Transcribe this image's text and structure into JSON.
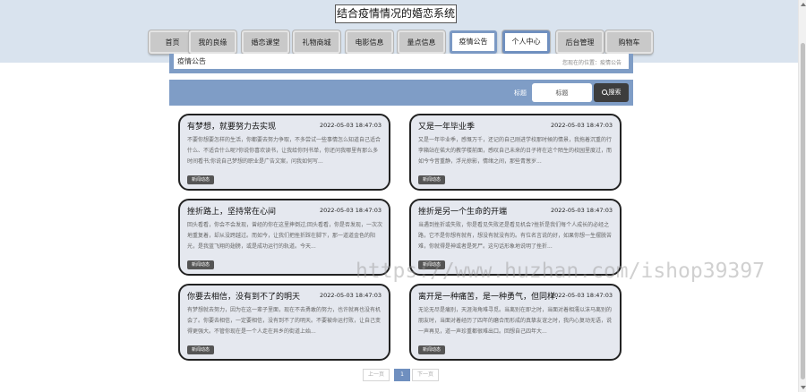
{
  "site": {
    "title": "结合疫情情况的婚恋系统"
  },
  "nav": [
    {
      "label": "首页"
    },
    {
      "label": "我的良缘"
    },
    {
      "label": "婚恋课堂"
    },
    {
      "label": "礼物商城"
    },
    {
      "label": "电影信息"
    },
    {
      "label": "量点信息"
    },
    {
      "label": "疫情公告"
    },
    {
      "label": "个人中心"
    },
    {
      "label": "后台管理"
    },
    {
      "label": "购物车"
    }
  ],
  "breadcrumb": {
    "title": "疫情公告",
    "path": "您现在的位置：疫情公告"
  },
  "search": {
    "label": "标题",
    "placeholder": "标题",
    "button": "搜索"
  },
  "articles": [
    {
      "title": "有梦想，就要努力去实现",
      "date": "2022-05-03 18:47:03",
      "excerpt": "不要你想要怎样的生活，你都要去努力争取，不多尝试一些事情怎么知道自己适合什么、不适合什么呢?你说你喜欢读书，让我给你列书单，你还问我哪里有那么多时间看书;你说自己梦想的职业是广告文案，问我如何写...",
      "tag": "新闻动态"
    },
    {
      "title": "又是一年毕业季",
      "date": "2022-05-03 18:47:03",
      "excerpt": "又是一年毕业季，感慨万千，还记的自己刚进学校那时候的情景，我拖着沉重的行李箱站在偌大的教学楼前面，感叹自己未来的日子将在这个陌生的校园里度过，而如今今昔重静，浮光掠影，情绪之间，那些青葱岁...",
      "tag": "新闻动态"
    },
    {
      "title": "挫折路上，坚持常在心间",
      "date": "2022-05-03 18:47:03",
      "excerpt": "回头看看，你会不会发现，曾经的你在这里摔倒过;回头看看，你是否发现，一次次地重复着，却从没跨越过。而如今，让我们把挫折踩在脚下，那一道道金色的阳光，是我蓝飞翔的翅膀，或是成功运行的轨道。今天...",
      "tag": "新闻动态"
    },
    {
      "title": "挫折是另一个生命的开端",
      "date": "2022-05-03 18:47:03",
      "excerpt": "当遇到挫折或失败，你是看见失败还是看见机会?挫折是我们每个人成长的必经之路，它不是你想有就有，想没有就没有的。有位名言说的好，如果你想一生摆脱苦难，你就得是神或者是死尸。这句话形象地说明了挫折...",
      "tag": "新闻动态"
    },
    {
      "title": "你要去相信，没有到不了的明天",
      "date": "2022-05-03 18:47:03",
      "excerpt": "有梦想就去努力，因为在这一辈子里面，现在不去勇敢的努力，也许就再也没有机会了。你要去相信，一定要相信，没有到不了的明天。不要被命运打败，让自己变得更强大。不管你现在是一个人走在异乡的街道上始...",
      "tag": "新闻动态"
    },
    {
      "title": "离开是一种痛苦，是一种勇气，但同样…",
      "date": "2022-05-03 18:47:03",
      "excerpt": "无论无尽是痛别，天涯海角难寻觅。当离别在即之时，当面对着相濡以沫马离别的朋友时，当面对着经历了四年的磨合而形成的真挚友谊之时，我内心复动无语，说一声再见，道一声珍重都很难出口。回想自己四年大...",
      "tag": "新闻动态"
    }
  ],
  "pagination": {
    "prev": "上一页",
    "current": "1",
    "next": "下一页"
  },
  "watermark": "https://www.huzhan.com/ishop39397"
}
